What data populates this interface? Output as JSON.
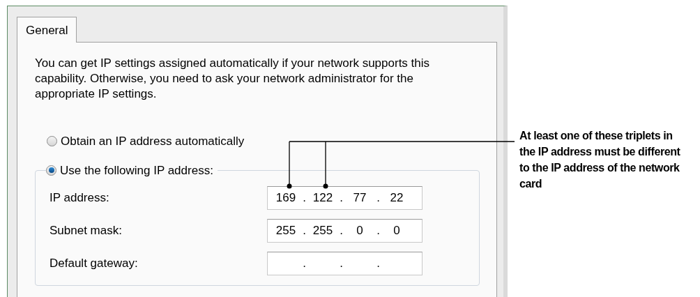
{
  "tabs": [
    {
      "label": "General",
      "selected": true
    }
  ],
  "description": "You can get IP settings assigned automatically if your network supports this capability. Otherwise, you need to ask your network administrator for the appropriate IP settings.",
  "radios": [
    {
      "label": "Obtain an IP address automatically",
      "selected": false
    },
    {
      "label": "Use the following IP address:",
      "selected": true
    }
  ],
  "octet_separator": ".",
  "fields": [
    {
      "label": "IP address:",
      "octets": [
        "169",
        "122",
        "77",
        "22"
      ]
    },
    {
      "label": "Subnet mask:",
      "octets": [
        "255",
        "255",
        "0",
        "0"
      ]
    },
    {
      "label": "Default gateway:"
    }
  ],
  "annotation": "At least one of these triplets in the IP address must be different to the IP address of the network card"
}
